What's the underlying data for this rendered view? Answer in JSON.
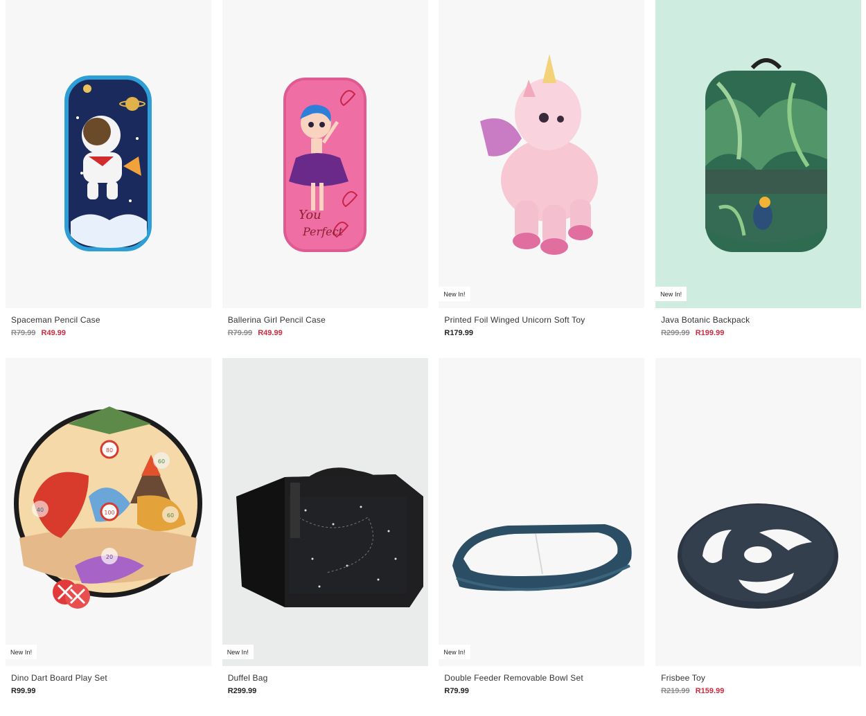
{
  "products": [
    {
      "name": "Spaceman Pencil Case",
      "was": "R79.99",
      "now": "R49.99",
      "badge": ""
    },
    {
      "name": "Ballerina Girl Pencil Case",
      "was": "R79.99",
      "now": "R49.99",
      "badge": ""
    },
    {
      "name": "Printed Foil Winged Unicorn Soft Toy",
      "was": "",
      "now": "R179.99",
      "badge": "New In!"
    },
    {
      "name": "Java Botanic Backpack",
      "was": "R299.99",
      "now": "R199.99",
      "badge": "New In!"
    },
    {
      "name": "Dino Dart Board Play Set",
      "was": "",
      "now": "R99.99",
      "badge": "New In!"
    },
    {
      "name": "Duffel Bag",
      "was": "",
      "now": "R299.99",
      "badge": "New In!"
    },
    {
      "name": "Double Feeder Removable Bowl Set",
      "was": "",
      "now": "R79.99",
      "badge": "New In!"
    },
    {
      "name": "Frisbee Toy",
      "was": "R219.99",
      "now": "R159.99",
      "badge": ""
    }
  ],
  "dartboard_scores": [
    "40",
    "60",
    "80",
    "100",
    "60",
    "20"
  ],
  "colors": {
    "sale_price": "#d1293d",
    "was_price": "#8c8c8c",
    "image_bg": "#f7f7f7",
    "backpack_bg": "#cfece0"
  }
}
